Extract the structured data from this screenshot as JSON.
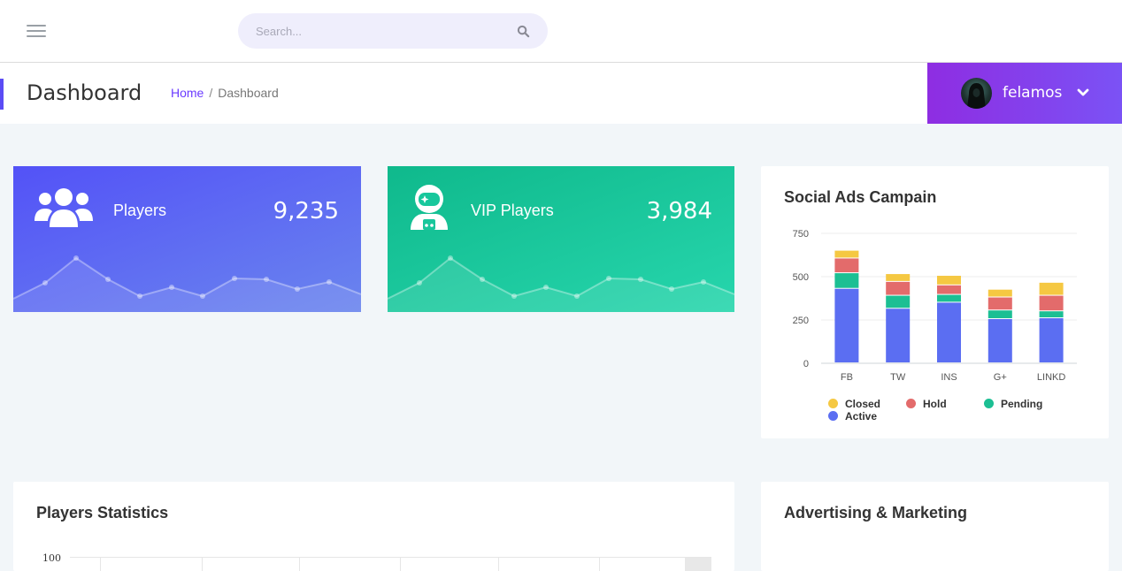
{
  "search": {
    "placeholder": "Search..."
  },
  "header": {
    "title": "Dashboard",
    "breadcrumb": {
      "home": "Home",
      "separator": "/",
      "current": "Dashboard"
    },
    "user": {
      "name": "felamos"
    }
  },
  "stats": [
    {
      "label": "Players",
      "value": "9,235",
      "icon": "users-icon"
    },
    {
      "label": "VIP Players",
      "value": "3,984",
      "icon": "astronaut-icon"
    }
  ],
  "cards": {
    "social_title": "Social Ads Campain",
    "players_stats_title": "Players Statistics",
    "players_stats_ytick": "100",
    "advertising_title": "Advertising & Marketing"
  },
  "colors": {
    "accent": "#5b4cf5",
    "closed": "#f5c842",
    "hold": "#e36b6b",
    "pending": "#1cbf93",
    "active": "#5b6ef2"
  },
  "chart_data": {
    "type": "bar",
    "stacked": true,
    "title": "Social Ads Campain",
    "categories": [
      "FB",
      "TW",
      "INS",
      "G+",
      "LINKD"
    ],
    "yticks": [
      "750",
      "500",
      "250",
      "0"
    ],
    "ylim": [
      0,
      750
    ],
    "grid": true,
    "legend_position": "bottom",
    "series": [
      {
        "name": "Active",
        "color": "#5b6ef2",
        "values": [
          430,
          315,
          350,
          255,
          260
        ]
      },
      {
        "name": "Pending",
        "color": "#1cbf93",
        "values": [
          90,
          75,
          45,
          50,
          40
        ]
      },
      {
        "name": "Hold",
        "color": "#e36b6b",
        "values": [
          85,
          80,
          55,
          75,
          90
        ]
      },
      {
        "name": "Closed",
        "color": "#f5c842",
        "values": [
          45,
          45,
          55,
          45,
          75
        ]
      }
    ]
  }
}
